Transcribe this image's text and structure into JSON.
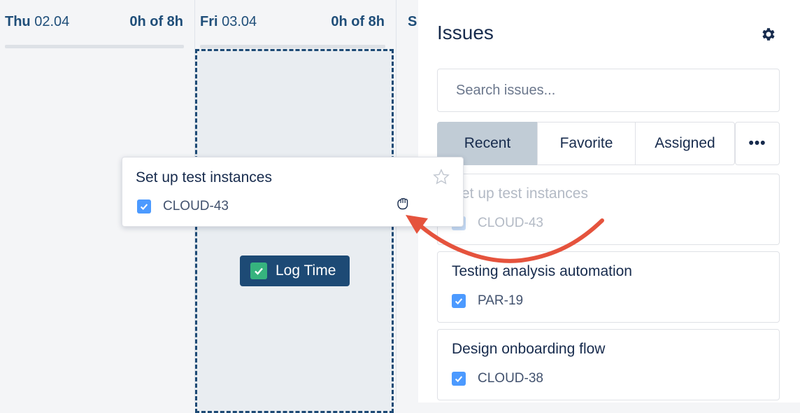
{
  "calendar": {
    "days": [
      {
        "name": "Thu",
        "date": "02.04",
        "hours": "0h of 8h"
      },
      {
        "name": "Fri",
        "date": "03.04",
        "hours": "0h of 8h"
      },
      {
        "name": "S"
      }
    ],
    "log_time_label": "Log Time"
  },
  "issues_panel": {
    "title": "Issues",
    "settings_icon": "gear-icon",
    "search": {
      "placeholder": "Search issues...",
      "value": ""
    },
    "tabs": [
      {
        "label": "Recent",
        "active": true
      },
      {
        "label": "Favorite",
        "active": false
      },
      {
        "label": "Assigned",
        "active": false
      },
      {
        "label": "•••",
        "active": false
      }
    ],
    "items": [
      {
        "title": "Set up test instances",
        "key": "CLOUD-43",
        "state": "dragging"
      },
      {
        "title": "Testing analysis automation",
        "key": "PAR-19"
      },
      {
        "title": "Design onboarding flow",
        "key": "CLOUD-38"
      }
    ]
  },
  "dragged_item": {
    "title": "Set up test instances",
    "key": "CLOUD-43",
    "star_icon": "star-outline-icon",
    "cursor_icon": "grab-hand-icon"
  },
  "colors": {
    "accent_dark": "#1d4a75",
    "checkbox_blue": "#4c9aff",
    "log_check_green": "#36b37e",
    "annotation_arrow": "#e5533d",
    "active_tab": "#c1ccd6"
  }
}
